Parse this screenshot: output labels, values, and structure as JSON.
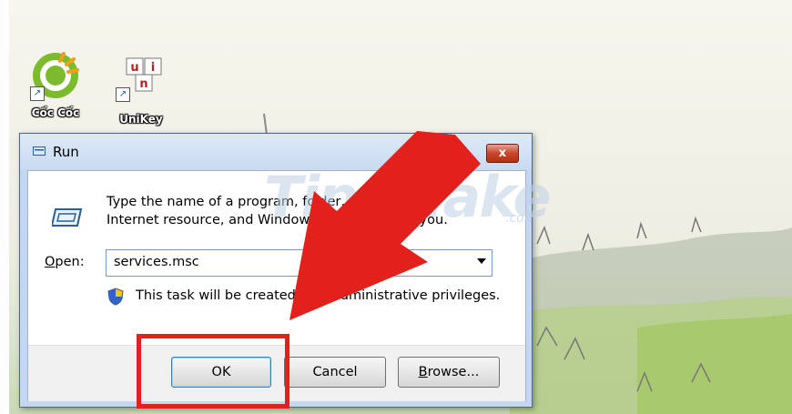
{
  "desktop": {
    "icons": [
      {
        "label": "Cốc Cốc",
        "icon": "coccoc-browser-icon"
      },
      {
        "label": "UniKey",
        "icon": "unikey-icon"
      }
    ]
  },
  "run_dialog": {
    "title": "Run",
    "close_label": "x",
    "description": "Type the name of a program, folder, document, or Internet resource, and Windows will open it for you.",
    "open_label_underlined": "O",
    "open_label_rest": "pen:",
    "open_value": "services.msc",
    "admin_note": "This task will be created with administrative privileges.",
    "buttons": {
      "ok": "OK",
      "cancel": "Cancel",
      "browse_underlined": "B",
      "browse_rest": "rowse..."
    }
  },
  "watermark": {
    "text": "TipsMake",
    "suffix": ".com"
  },
  "colors": {
    "annotation_red": "#e2201c",
    "dialog_frame": "#c4d7ee",
    "close_red": "#c6462d"
  }
}
